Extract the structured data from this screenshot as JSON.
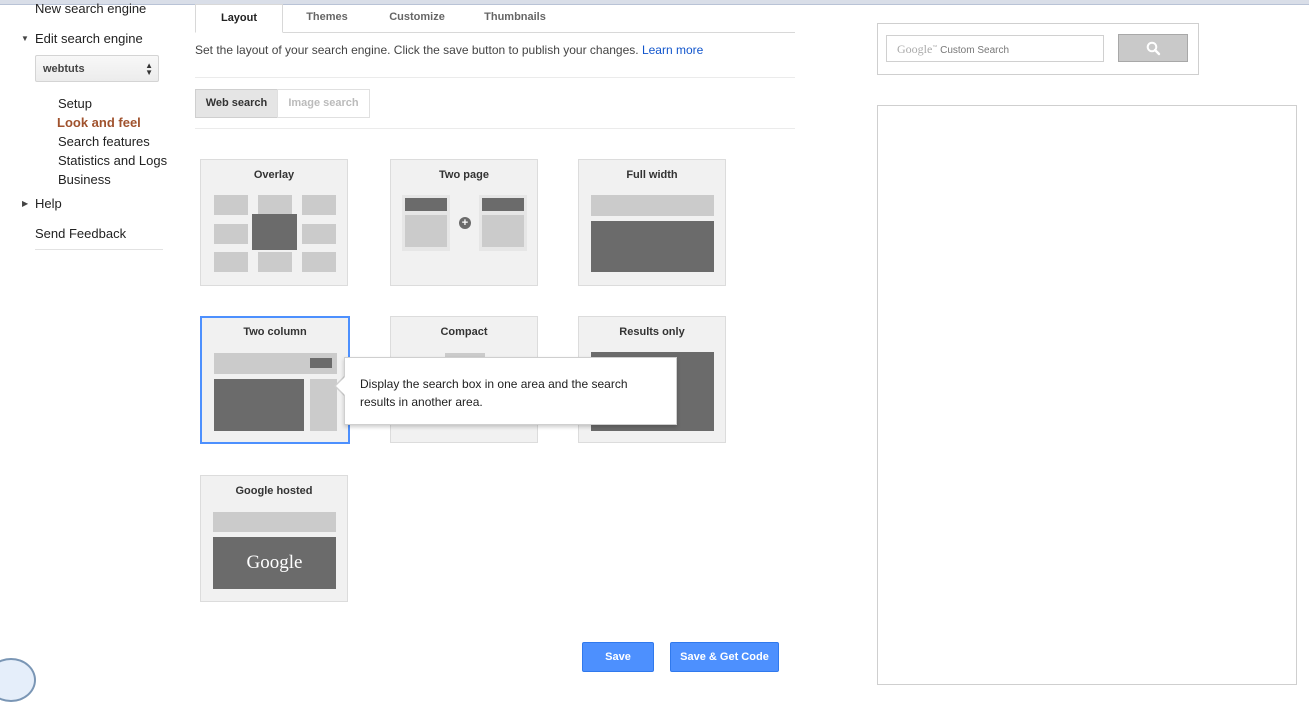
{
  "sidebar": {
    "new_engine": "New search engine",
    "edit_engine": "Edit search engine",
    "engine_select": "webtuts",
    "items": [
      {
        "label": "Setup"
      },
      {
        "label": "Look and feel"
      },
      {
        "label": "Search features"
      },
      {
        "label": "Statistics and Logs"
      },
      {
        "label": "Business"
      }
    ],
    "help": "Help",
    "feedback": "Send Feedback"
  },
  "tabs": [
    {
      "label": "Layout",
      "active": true
    },
    {
      "label": "Themes"
    },
    {
      "label": "Customize"
    },
    {
      "label": "Thumbnails"
    }
  ],
  "description": {
    "text": "Set the layout of your search engine. Click the save button to publish your changes.",
    "link": "Learn more"
  },
  "search_type": {
    "web": "Web search",
    "image": "Image search"
  },
  "layouts": [
    {
      "title": "Overlay"
    },
    {
      "title": "Two page"
    },
    {
      "title": "Full width"
    },
    {
      "title": "Two column",
      "selected": true
    },
    {
      "title": "Compact"
    },
    {
      "title": "Results only"
    },
    {
      "title": "Google hosted",
      "logo": "Google"
    }
  ],
  "tooltip": "Display the search box in one area and the search results in another area.",
  "buttons": {
    "save": "Save",
    "save_get_code": "Save & Get Code"
  },
  "preview": {
    "brand": "Google",
    "placeholder": "Custom Search"
  },
  "colors": {
    "accent": "#4d90fe",
    "active_nav": "#a0522d",
    "link": "#1155cc"
  }
}
